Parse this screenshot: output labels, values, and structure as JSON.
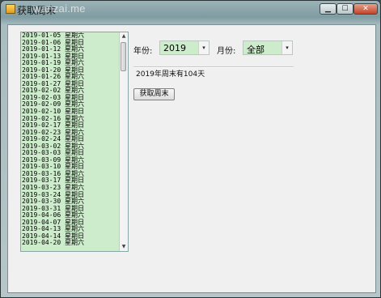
{
  "window": {
    "title": "获取周末",
    "watermark": "wanzai.me",
    "controls": {
      "minimize": "▁",
      "maximize": "☐",
      "close": "✕"
    }
  },
  "list": {
    "items": [
      "2019-01-05 星期六",
      "2019-01-06 星期日",
      "2019-01-12 星期六",
      "2019-01-13 星期日",
      "2019-01-19 星期六",
      "2019-01-20 星期日",
      "2019-01-26 星期六",
      "2019-01-27 星期日",
      "2019-02-02 星期六",
      "2019-02-03 星期日",
      "2019-02-09 星期六",
      "2019-02-10 星期日",
      "2019-02-16 星期六",
      "2019-02-17 星期日",
      "2019-02-23 星期六",
      "2019-02-24 星期日",
      "2019-03-02 星期六",
      "2019-03-03 星期日",
      "2019-03-09 星期六",
      "2019-03-10 星期日",
      "2019-03-16 星期六",
      "2019-03-17 星期日",
      "2019-03-23 星期六",
      "2019-03-24 星期日",
      "2019-03-30 星期六",
      "2019-03-31 星期日",
      "2019-04-06 星期六",
      "2019-04-07 星期日",
      "2019-04-13 星期六",
      "2019-04-14 星期日",
      "2019-04-20 星期六"
    ],
    "scroll_up": "▲",
    "scroll_down": "▼"
  },
  "filters": {
    "year_label": "年份:",
    "year_value": "2019",
    "month_label": "月份:",
    "month_value": "全部",
    "arrow": "▾"
  },
  "result_text": "2019年周末有104天",
  "action_button": "获取周末",
  "colors": {
    "list_background": "#cdeccb",
    "combo_background": "#cdeccb"
  }
}
